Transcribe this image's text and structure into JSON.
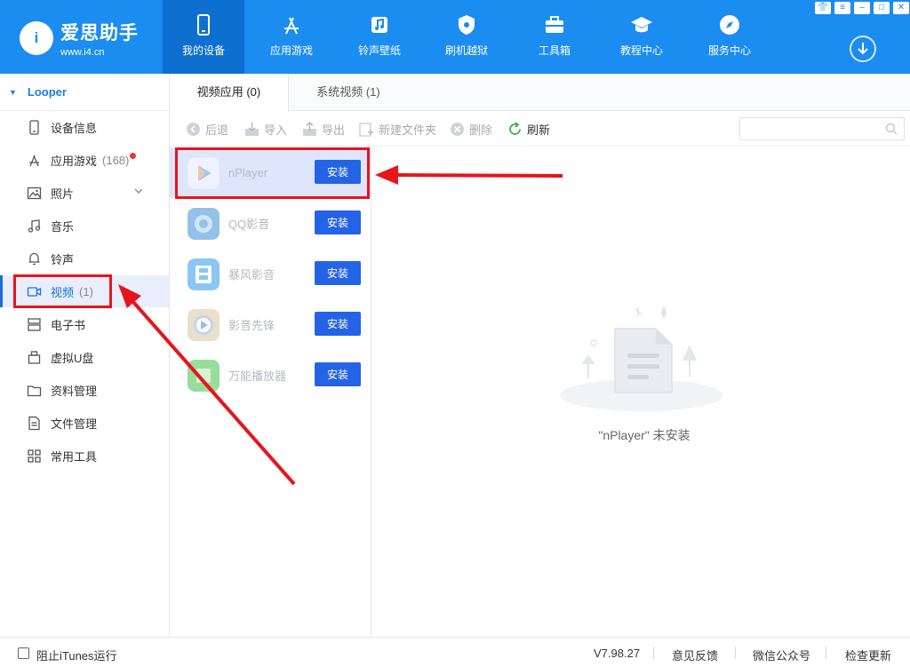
{
  "app": {
    "logo_badge": "i",
    "logo_name": "爱思助手",
    "logo_url": "www.i4.cn"
  },
  "nav_tabs": [
    {
      "label": "我的设备",
      "icon": "phone-icon",
      "active": true
    },
    {
      "label": "应用游戏",
      "icon": "app-store-icon",
      "active": false
    },
    {
      "label": "铃声壁纸",
      "icon": "music-note-icon",
      "active": false
    },
    {
      "label": "刷机越狱",
      "icon": "shield-icon",
      "active": false
    },
    {
      "label": "工具箱",
      "icon": "toolbox-icon",
      "active": false
    },
    {
      "label": "教程中心",
      "icon": "graduation-cap-icon",
      "active": false
    },
    {
      "label": "服务中心",
      "icon": "compass-icon",
      "active": false
    }
  ],
  "window_controls": {
    "skin": "👕",
    "menu": "≡",
    "minimize": "–",
    "maximize": "□",
    "close": "✕"
  },
  "sidebar": {
    "device_name": "Looper",
    "items": [
      {
        "label": "设备信息",
        "icon": "device-info-icon"
      },
      {
        "label": "应用游戏",
        "icon": "app-store-icon",
        "count": "(168)",
        "badge": true
      },
      {
        "label": "照片",
        "icon": "photo-icon",
        "expandable": true
      },
      {
        "label": "音乐",
        "icon": "music-icon"
      },
      {
        "label": "铃声",
        "icon": "bell-icon"
      },
      {
        "label": "视频",
        "icon": "video-icon",
        "count": "(1)",
        "active": true
      },
      {
        "label": "电子书",
        "icon": "ebook-icon"
      },
      {
        "label": "虚拟U盘",
        "icon": "usb-drive-icon"
      },
      {
        "label": "资料管理",
        "icon": "folder-icon"
      },
      {
        "label": "文件管理",
        "icon": "file-icon"
      },
      {
        "label": "常用工具",
        "icon": "grid-icon"
      }
    ]
  },
  "content_tabs": [
    {
      "label": "视频应用 (0)",
      "active": true
    },
    {
      "label": "系统视频 (1)",
      "active": false
    }
  ],
  "toolbar": {
    "back": "后退",
    "import": "导入",
    "export": "导出",
    "new_folder": "新建文件夹",
    "delete": "删除",
    "refresh": "刷新"
  },
  "search": {
    "placeholder": ""
  },
  "apps": [
    {
      "name": "nPlayer",
      "install_label": "安装",
      "icon": "nplayer-icon",
      "color": "#e9f0ff",
      "selected": true
    },
    {
      "name": "QQ影音",
      "install_label": "安装",
      "icon": "qq-player-icon",
      "color": "#3f8fd8"
    },
    {
      "name": "暴风影音",
      "install_label": "安装",
      "icon": "baofeng-icon",
      "color": "#2e9be9"
    },
    {
      "name": "影音先锋",
      "install_label": "安装",
      "icon": "xianfeng-icon",
      "color": "#d9c6a0"
    },
    {
      "name": "万能播放器",
      "install_label": "安装",
      "icon": "universal-player-icon",
      "color": "#46c24a"
    }
  ],
  "empty_state": {
    "message": "\"nPlayer\" 未安装"
  },
  "status_bar": {
    "itunes_block": "阻止iTunes运行",
    "version": "V7.98.27",
    "feedback": "意见反馈",
    "wechat": "微信公众号",
    "update": "检查更新"
  },
  "colors": {
    "brand": "#1b8cf0",
    "install": "#2563e6",
    "annotation": "#e8141b"
  }
}
